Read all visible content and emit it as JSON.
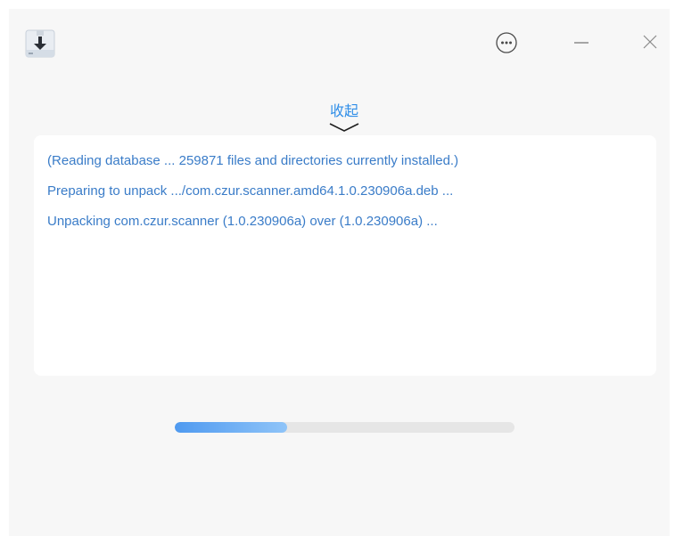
{
  "window": {
    "app_icon": "download-package-icon",
    "controls": {
      "menu_icon": "more-options-icon",
      "minimize_icon": "minimize-icon",
      "close_icon": "close-icon"
    }
  },
  "collapse": {
    "label": "收起",
    "icon": "chevron-down-icon"
  },
  "log": {
    "lines": [
      "(Reading database ... 259871 files and directories currently installed.)",
      "Preparing to unpack .../com.czur.scanner.amd64.1.0.230906a.deb ...",
      "Unpacking com.czur.scanner (1.0.230906a) over (1.0.230906a) ..."
    ]
  },
  "progress": {
    "fraction": 0.33
  },
  "colors": {
    "accent": "#2f8ee8",
    "log_text": "#3a7cc8",
    "window_bg": "#f7f7f7",
    "panel_bg": "#ffffff",
    "track": "#e6e6e6"
  }
}
